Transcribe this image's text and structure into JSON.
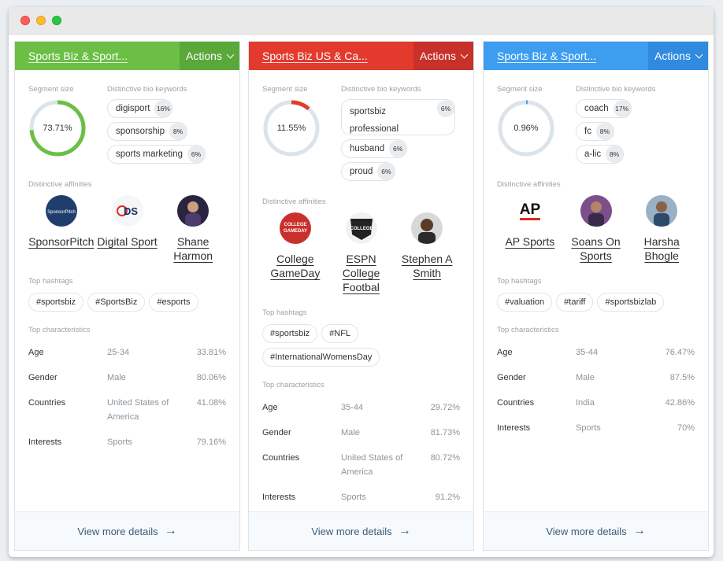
{
  "cards": [
    {
      "title": "Sports Biz & Sport...",
      "actions": "Actions",
      "header_color": "#6cbf45",
      "actions_color": "#5aa83a",
      "accent": "#6cbf45",
      "segment_label": "Segment size",
      "segment_value": "73.71%",
      "segment_fraction": 0.7371,
      "keywords_label": "Distinctive bio keywords",
      "keywords": [
        {
          "word": "digisport",
          "pct": "16%"
        },
        {
          "word": "sponsorship",
          "pct": "8%"
        },
        {
          "word": "sports marketing",
          "pct": "6%"
        }
      ],
      "affinities_label": "Distinctive affinities",
      "affinities": [
        {
          "name": "SponsorPitch",
          "icon": "sponsorpitch-logo"
        },
        {
          "name": "Digital Sport",
          "icon": "digital-sport-logo"
        },
        {
          "name": "Shane Harmon",
          "icon": "person-avatar"
        }
      ],
      "hashtags_label": "Top hashtags",
      "hashtags": [
        "#sportsbiz",
        "#SportsBiz",
        "#esports"
      ],
      "characteristics_label": "Top characteristics",
      "characteristics": [
        {
          "key": "Age",
          "value": "25-34",
          "pct": "33.81%"
        },
        {
          "key": "Gender",
          "value": "Male",
          "pct": "80.06%"
        },
        {
          "key": "Countries",
          "value": "United States of America",
          "pct": "41.08%"
        },
        {
          "key": "Interests",
          "value": "Sports",
          "pct": "79.16%"
        }
      ],
      "footer": "View more details"
    },
    {
      "title": "Sports Biz US & Ca...",
      "actions": "Actions",
      "header_color": "#e23b2e",
      "actions_color": "#c8302a",
      "accent": "#e23b2e",
      "segment_label": "Segment size",
      "segment_value": "11.55%",
      "segment_fraction": 0.1155,
      "keywords_label": "Distinctive bio keywords",
      "keywords": [
        {
          "word": "sportsbiz professional",
          "pct": "6%"
        },
        {
          "word": "husband",
          "pct": "6%"
        },
        {
          "word": "proud",
          "pct": "6%"
        }
      ],
      "affinities_label": "Distinctive affinities",
      "affinities": [
        {
          "name": "College GameDay",
          "icon": "college-gameday-logo"
        },
        {
          "name": "ESPN College Footbal",
          "icon": "espn-college-football-logo"
        },
        {
          "name": "Stephen A Smith",
          "icon": "person-avatar"
        }
      ],
      "hashtags_label": "Top hashtags",
      "hashtags": [
        "#sportsbiz",
        "#NFL",
        "#InternationalWomensDay"
      ],
      "characteristics_label": "Top characteristics",
      "characteristics": [
        {
          "key": "Age",
          "value": "35-44",
          "pct": "29.72%"
        },
        {
          "key": "Gender",
          "value": "Male",
          "pct": "81.73%"
        },
        {
          "key": "Countries",
          "value": "United States of America",
          "pct": "80.72%"
        },
        {
          "key": "Interests",
          "value": "Sports",
          "pct": "91.2%"
        }
      ],
      "footer": "View more details"
    },
    {
      "title": "Sports Biz & Sport...",
      "actions": "Actions",
      "header_color": "#3d9ef0",
      "actions_color": "#2f8ae0",
      "accent": "#3d9ef0",
      "segment_label": "Segment size",
      "segment_value": "0.96%",
      "segment_fraction": 0.0096,
      "keywords_label": "Distinctive bio keywords",
      "keywords": [
        {
          "word": "coach",
          "pct": "17%"
        },
        {
          "word": "fc",
          "pct": "8%"
        },
        {
          "word": "a-lic",
          "pct": "8%"
        }
      ],
      "affinities_label": "Distinctive affinities",
      "affinities": [
        {
          "name": "AP Sports",
          "icon": "ap-logo"
        },
        {
          "name": "Soans On Sports",
          "icon": "person-avatar"
        },
        {
          "name": "Harsha Bhogle",
          "icon": "person-avatar"
        }
      ],
      "hashtags_label": "Top hashtags",
      "hashtags": [
        "#valuation",
        "#tariff",
        "#sportsbizlab"
      ],
      "characteristics_label": "Top characteristics",
      "characteristics": [
        {
          "key": "Age",
          "value": "35-44",
          "pct": "76.47%"
        },
        {
          "key": "Gender",
          "value": "Male",
          "pct": "87.5%"
        },
        {
          "key": "Countries",
          "value": "India",
          "pct": "42.86%"
        },
        {
          "key": "Interests",
          "value": "Sports",
          "pct": "70%"
        }
      ],
      "footer": "View more details"
    }
  ]
}
